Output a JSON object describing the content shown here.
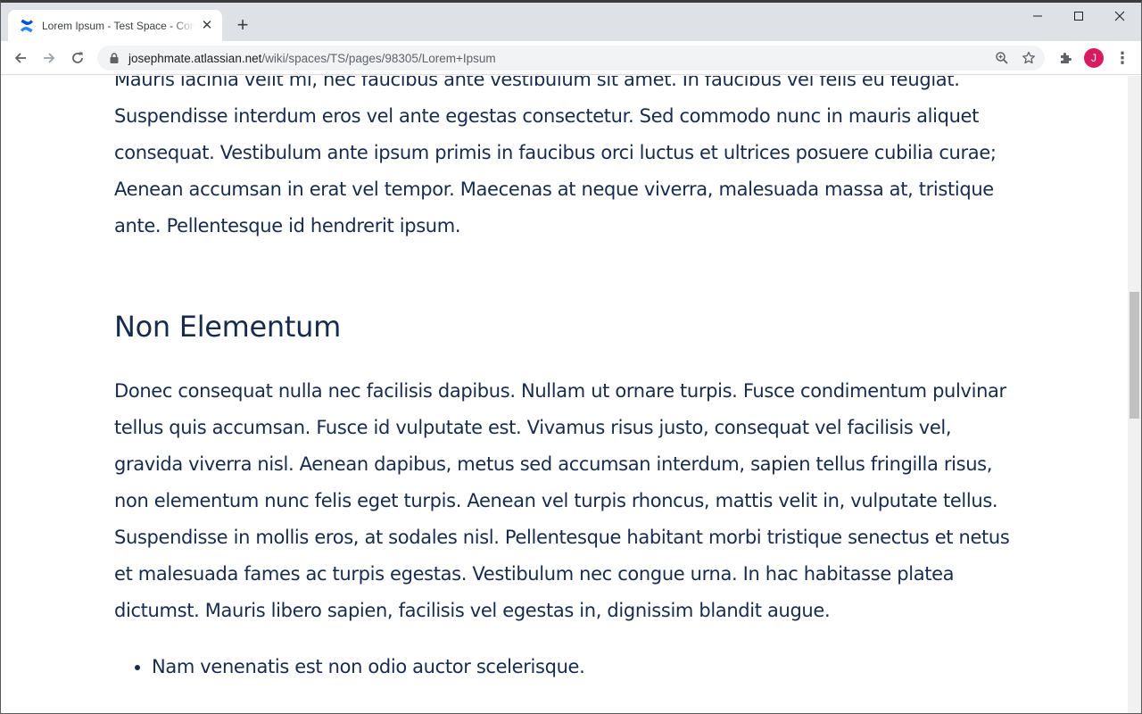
{
  "browser": {
    "tab_title": "Lorem Ipsum - Test Space - Confluence",
    "tab_close_glyph": "✕",
    "new_tab_glyph": "+",
    "url_host": "josephmate.atlassian.net",
    "url_path": "/wiki/spaces/TS/pages/98305/Lorem+Ipsum",
    "profile_initial": "J",
    "profile_color": "#d81b60",
    "menu_glyph": "⋮"
  },
  "article": {
    "paragraph_1": "Mauris lacinia velit mi, nec faucibus ante vestibulum sit amet. In faucibus vel felis eu feugiat. Suspendisse interdum eros vel ante egestas consectetur. Sed commodo nunc in mauris aliquet consequat. Vestibulum ante ipsum primis in faucibus orci luctus et ultrices posuere cubilia curae; Aenean accumsan in erat vel tempor. Maecenas at neque viverra, malesuada massa at, tristique ante. Pellentesque id hendrerit ipsum.",
    "heading": "Non Elementum",
    "paragraph_2": "Donec consequat nulla nec facilisis dapibus. Nullam ut ornare turpis. Fusce condimentum pulvinar tellus quis accumsan. Fusce id vulputate est. Vivamus risus justo, consequat vel facilisis vel, gravida viverra nisl. Aenean dapibus, metus sed accumsan interdum, sapien tellus fringilla risus, non elementum nunc felis eget turpis. Aenean vel turpis rhoncus, mattis velit in, vulputate tellus. Suspendisse in mollis eros, at sodales nisl. Pellentesque habitant morbi tristique senectus et netus et malesuada fames ac turpis egestas. Vestibulum nec congue urna. In hac habitasse platea dictumst. Mauris libero sapien, facilisis vel egestas in, dignissim blandit augue.",
    "list_items": [
      "Nam venenatis est non odio auctor scelerisque."
    ]
  },
  "colors": {
    "text": "#172b4d",
    "tabstrip": "#dee1e6",
    "confluence_blue": "#2684ff"
  }
}
